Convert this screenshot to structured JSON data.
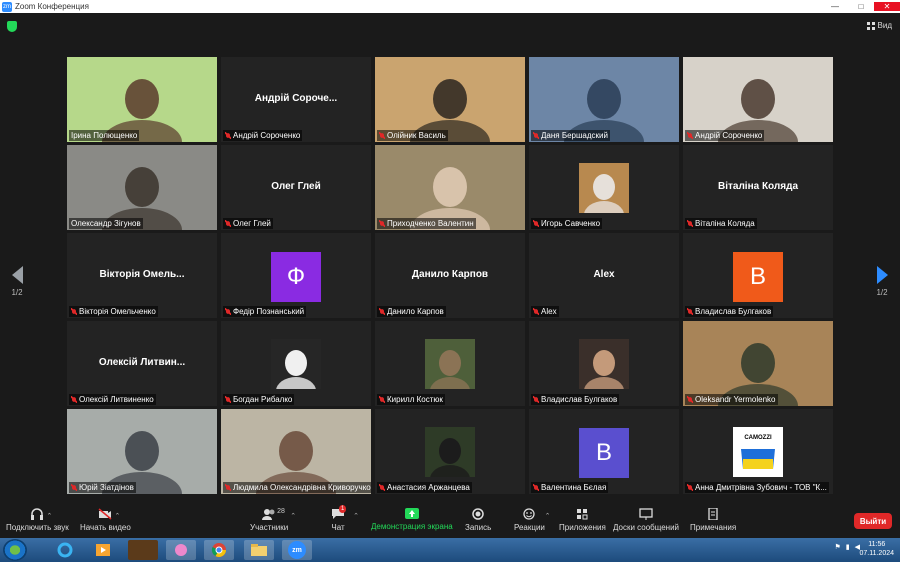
{
  "window": {
    "title": "Zoom Конференция",
    "app_badge": "zm",
    "controls": [
      "—",
      "□",
      "✕"
    ]
  },
  "meeting": {
    "view_label": "Вид",
    "page_left": "1/2",
    "page_right": "1/2"
  },
  "participants": [
    {
      "name": "Ірина Полющенко",
      "type": "video",
      "muted": false,
      "photo_bg": "#b6d88a",
      "photo_fg": "#5a3b2c"
    },
    {
      "name": "Андрій Сороченко",
      "display": "Андрій Сороче...",
      "type": "name",
      "muted": true
    },
    {
      "name": "Олійник Василь",
      "type": "video",
      "muted": true,
      "photo_bg": "#caa46f",
      "photo_fg": "#2b2620"
    },
    {
      "name": "Даня Бершадский",
      "type": "video",
      "muted": true,
      "photo_bg": "#6d86a6",
      "photo_fg": "#2a3d56"
    },
    {
      "name": "Андрій Сороченко",
      "type": "video",
      "muted": true,
      "photo_bg": "#d7d2c9",
      "photo_fg": "#4a3a2f"
    },
    {
      "name": "Олександр Зігунов",
      "type": "video",
      "muted": false,
      "active": true,
      "photo_bg": "#8a8a86",
      "photo_fg": "#3a332c"
    },
    {
      "name": "Олег Глей",
      "display": "Олег Глей",
      "type": "name",
      "muted": true
    },
    {
      "name": "Приходченко Валентин",
      "type": "video",
      "muted": true,
      "photo_bg": "#9a8a6a",
      "photo_fg": "#e3ccb6"
    },
    {
      "name": "Игорь Савченко",
      "type": "image",
      "muted": true,
      "photo_bg": "#b8894f",
      "photo_fg": "#e6e0da"
    },
    {
      "name": "Віталіна Коляда",
      "display": "Віталіна Коляда",
      "type": "name",
      "muted": true
    },
    {
      "name": "Вікторія Омельченко",
      "display": "Вікторія Омель...",
      "type": "name",
      "muted": true
    },
    {
      "name": "Федір Познанський",
      "type": "letter",
      "letter": "Ф",
      "color": "#8a2be2",
      "muted": true
    },
    {
      "name": "Данило Карпов",
      "display": "Данило Карпов",
      "type": "name",
      "muted": true
    },
    {
      "name": "Alex",
      "display": "Alex",
      "type": "name",
      "muted": true
    },
    {
      "name": "Владислав Булгаков",
      "type": "letter",
      "letter": "B",
      "color": "#f05a1a",
      "muted": true
    },
    {
      "name": "Олексій Литвиненко",
      "display": "Олексій Литвин...",
      "type": "name",
      "muted": true
    },
    {
      "name": "Богдан Рибалко",
      "type": "image",
      "muted": true,
      "photo_bg": "#262626",
      "photo_fg": "#f0f0f0"
    },
    {
      "name": "Кирилл Костюк",
      "type": "image",
      "muted": true,
      "photo_bg": "#4e5f3a",
      "photo_fg": "#8b7355"
    },
    {
      "name": "Владислав Булгаков",
      "type": "image",
      "muted": true,
      "photo_bg": "#3a2f2a",
      "photo_fg": "#c49a7a"
    },
    {
      "name": "Oleksandr Yermolenko",
      "type": "video",
      "muted": true,
      "photo_bg": "#a88458",
      "photo_fg": "#2f3a2c"
    },
    {
      "name": "Юрій Зіатдінов",
      "type": "video",
      "muted": true,
      "photo_bg": "#a7aca9",
      "photo_fg": "#3b3f46"
    },
    {
      "name": "Людмила Олександрівна Криворучко",
      "display": "Людмила Олександрівна Криворуч...",
      "type": "video",
      "muted": true,
      "photo_bg": "#bcb5a4",
      "photo_fg": "#6a4a3a"
    },
    {
      "name": "Анастасия Аржанцева",
      "type": "image",
      "muted": true,
      "photo_bg": "#2e3b27",
      "photo_fg": "#1c1c1c"
    },
    {
      "name": "Валентина Бєлая",
      "type": "letter",
      "letter": "B",
      "color": "#5a4fcf",
      "muted": true
    },
    {
      "name": "Анна Дмитрівна Зубович - ТОВ \"К...",
      "type": "image",
      "muted": true,
      "photo_bg": "#ffffff",
      "photo_fg": "#1e6fd9",
      "logo": "CAMOZZI"
    }
  ],
  "toolbar": {
    "join_audio": "Подключить звук",
    "start_video": "Начать видео",
    "participants": "Участники",
    "participants_count": "28",
    "chat": "Чат",
    "chat_badge": "1",
    "share": "Демонстрация экрана",
    "record": "Запись",
    "reactions": "Реакции",
    "apps": "Приложения",
    "whiteboards": "Доски сообщений",
    "notes": "Примечания",
    "leave": "Выйти"
  },
  "taskbar": {
    "apps": [
      "ie-icon",
      "media-icon",
      "game-icon",
      "paint-icon",
      "chrome-icon",
      "folder-icon",
      "zoom-icon"
    ],
    "zoom_badge": "zm",
    "time": "11:56",
    "date": "07.11.2024"
  },
  "colors": {
    "accent": "#2d8cff",
    "share_green": "#23d959",
    "leave_red": "#e02828",
    "active_outline": "#f5e76a"
  }
}
